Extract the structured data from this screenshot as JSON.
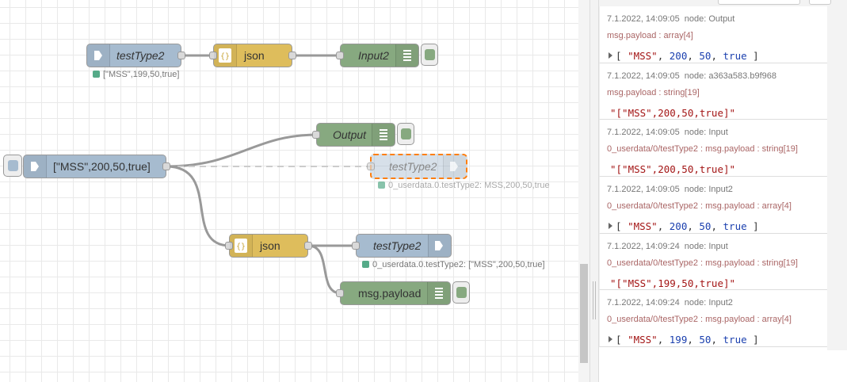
{
  "flow": {
    "inject_top": {
      "label": "testType2",
      "status": "[\"MSS\",199,50,true]"
    },
    "json_top": {
      "label": "json"
    },
    "debug_input2": {
      "label": "Input2"
    },
    "debug_output": {
      "label": "Output"
    },
    "inject_main": {
      "label": "[\"MSS\",200,50,true]"
    },
    "ghost_node": {
      "label": "testType2",
      "status": "0_userdata.0.testType2: MSS,200,50,true"
    },
    "json_bottom": {
      "label": "json"
    },
    "iobroker_out": {
      "label": "testType2",
      "status": "0_userdata.0.testType2: [\"MSS\",200,50,true]"
    },
    "debug_payload": {
      "label": "msg.payload"
    },
    "colors": {
      "inject": "#a6bbcf",
      "json": "#debd5c",
      "debug": "#87a980",
      "status_dot": "#5a8",
      "selection": "#ff7f0e"
    }
  },
  "debug": {
    "messages": [
      {
        "time": "7.1.2022, 14:09:05",
        "node": "node: Output",
        "topic": "msg.payload : array[4]",
        "value": "[ \"MSS\", 200, 50, true ]",
        "type": "array"
      },
      {
        "time": "7.1.2022, 14:09:05",
        "node": "node: a363a583.b9f968",
        "topic": "msg.payload : string[19]",
        "value": "\"[\"MSS\",200,50,true]\"",
        "type": "string"
      },
      {
        "time": "7.1.2022, 14:09:05",
        "node": "node: Input",
        "topic": "0_userdata/0/testType2 : msg.payload : string[19]",
        "value": "\"[\"MSS\",200,50,true]\"",
        "type": "string"
      },
      {
        "time": "7.1.2022, 14:09:05",
        "node": "node: Input2",
        "topic": "0_userdata/0/testType2 : msg.payload : array[4]",
        "value": "[ \"MSS\", 200, 50, true ]",
        "type": "array"
      },
      {
        "time": "7.1.2022, 14:09:24",
        "node": "node: Input",
        "topic": "0_userdata/0/testType2 : msg.payload : string[19]",
        "value": "\"[\"MSS\",199,50,true]\"",
        "type": "string"
      },
      {
        "time": "7.1.2022, 14:09:24",
        "node": "node: Input2",
        "topic": "0_userdata/0/testType2 : msg.payload : array[4]",
        "value": "[ \"MSS\", 199, 50, true ]",
        "type": "array"
      }
    ]
  }
}
